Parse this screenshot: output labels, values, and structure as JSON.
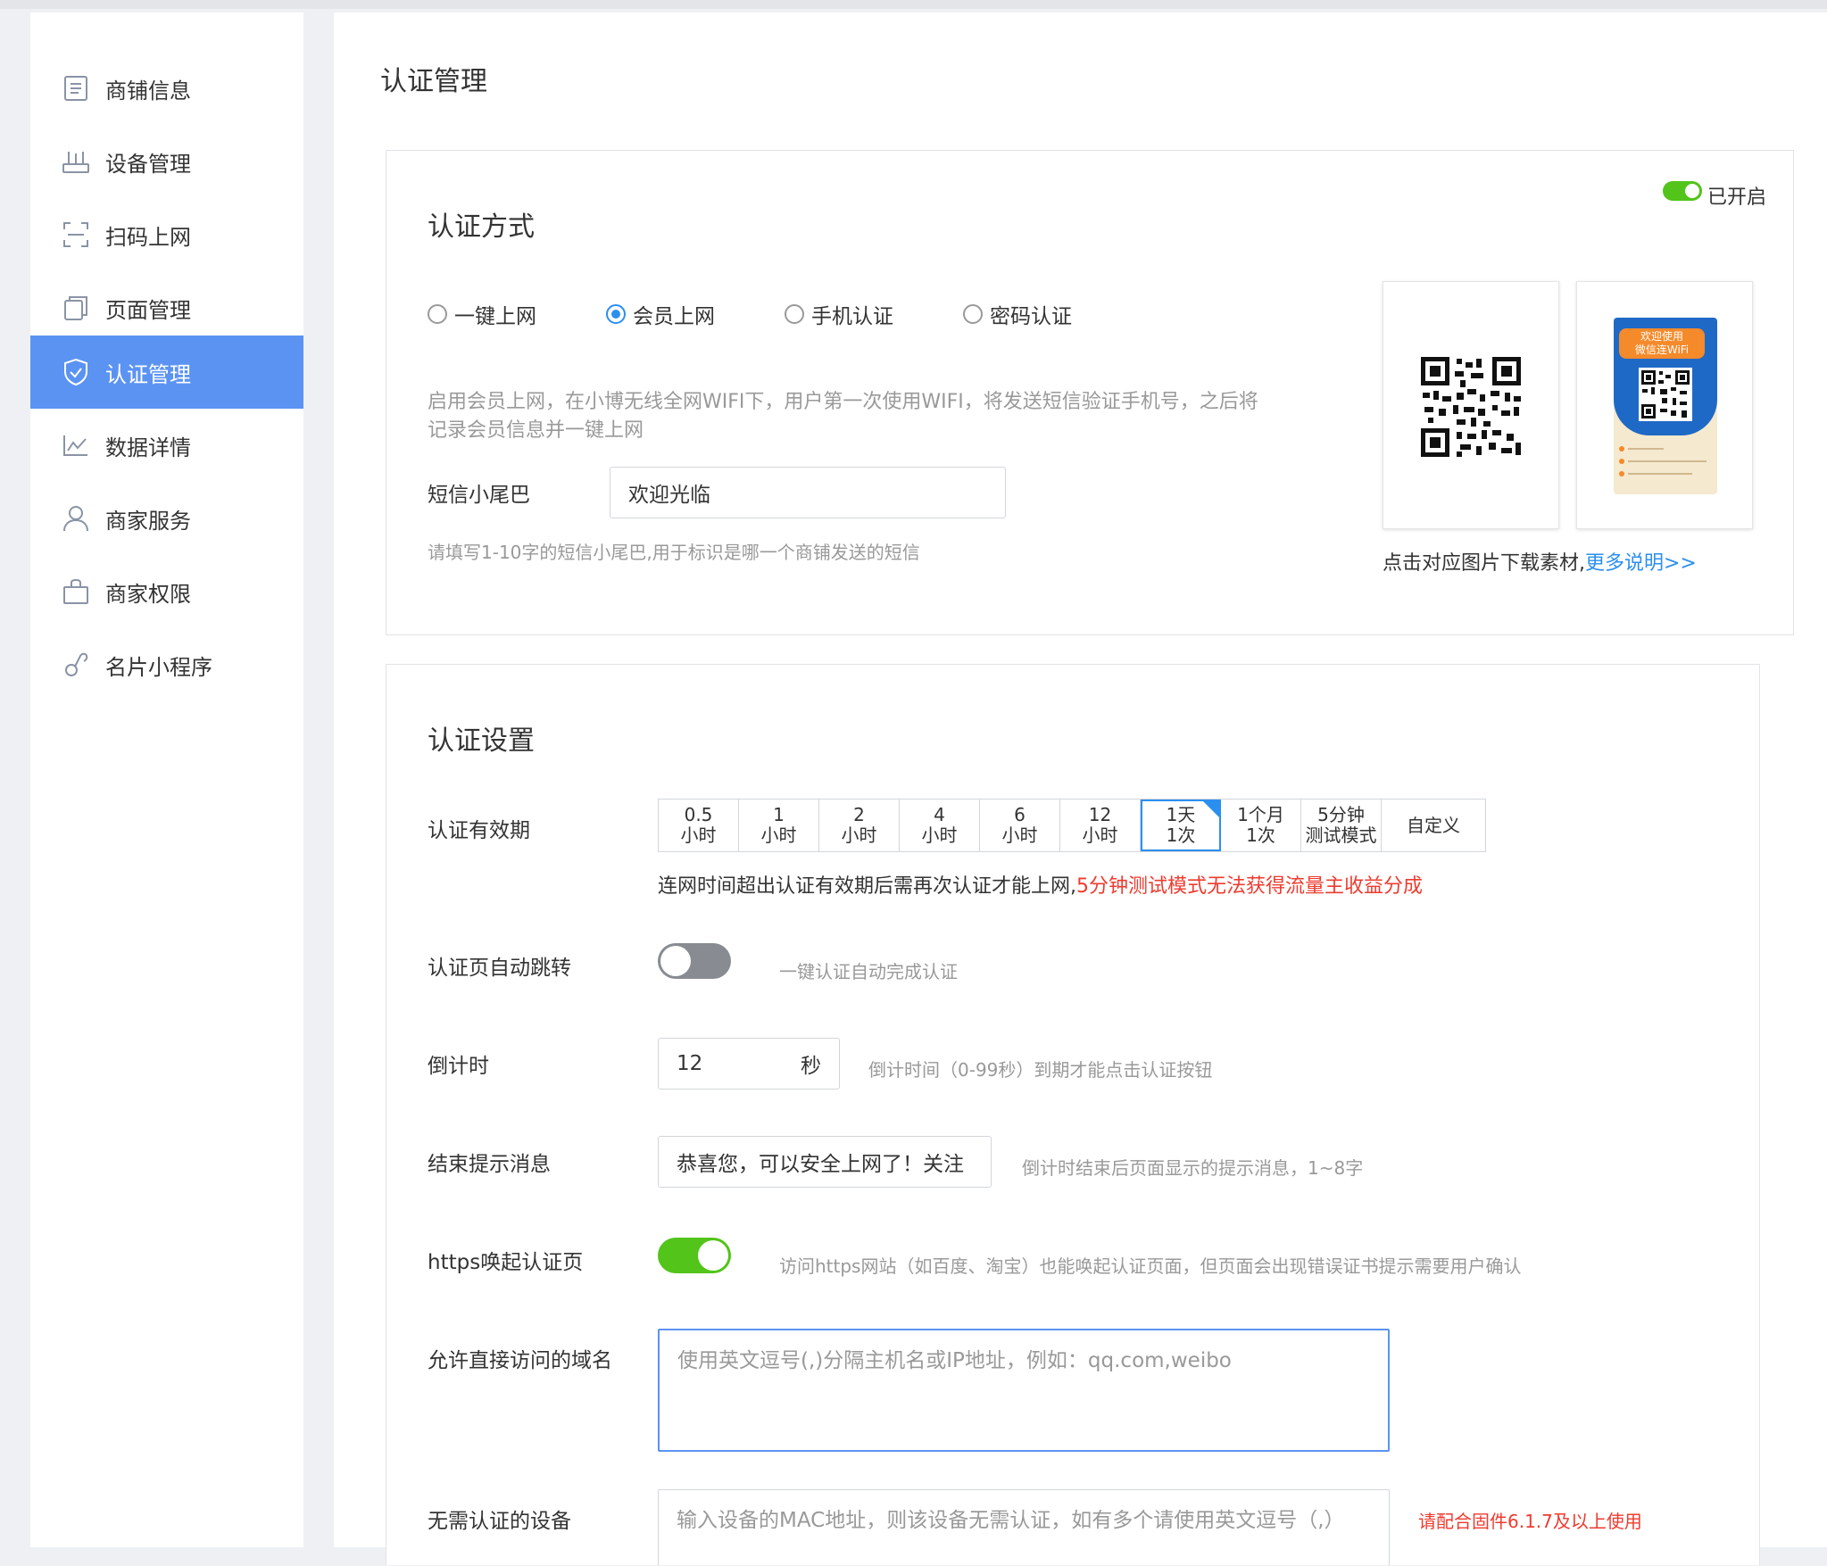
{
  "sidebar": {
    "items": [
      {
        "label": "商铺信息",
        "icon": "document-icon",
        "active": false
      },
      {
        "label": "设备管理",
        "icon": "router-icon",
        "active": false
      },
      {
        "label": "扫码上网",
        "icon": "scan-icon",
        "active": false
      },
      {
        "label": "页面管理",
        "icon": "pages-icon",
        "active": false
      },
      {
        "label": "认证管理",
        "icon": "shield-check-icon",
        "active": true
      },
      {
        "label": "数据详情",
        "icon": "chart-line-icon",
        "active": false
      },
      {
        "label": "商家服务",
        "icon": "user-icon",
        "active": false
      },
      {
        "label": "商家权限",
        "icon": "bag-icon",
        "active": false
      },
      {
        "label": "名片小程序",
        "icon": "link-icon",
        "active": false
      }
    ]
  },
  "page": {
    "title": "认证管理"
  },
  "auth_method": {
    "title": "认证方式",
    "toggle_label": "已开启",
    "toggle_on": true,
    "options": [
      {
        "label": "一键上网",
        "checked": false
      },
      {
        "label": "会员上网",
        "checked": true
      },
      {
        "label": "手机认证",
        "checked": false
      },
      {
        "label": "密码认证",
        "checked": false
      }
    ],
    "description_line1": "启用会员上网，在小博无线全网WIFI下，用户第一次使用WIFI，将发送短信验证手机号，之后将",
    "description_line2": "记录会员信息并一键上网",
    "sms_tail_label": "短信小尾巴",
    "sms_tail_value": "欢迎光临",
    "sms_tail_hint": "请填写1-10字的短信小尾巴,用于标识是哪一个商铺发送的短信",
    "poster_title_line1": "欢迎使用",
    "poster_title_line2": "微信连WiFi",
    "download_text": "点击对应图片下载素材,",
    "more_link": "更多说明>>"
  },
  "auth_settings": {
    "title": "认证设置",
    "validity_label": "认证有效期",
    "validity_options": [
      {
        "line1": "0.5",
        "line2": "小时",
        "active": false
      },
      {
        "line1": "1",
        "line2": "小时",
        "active": false
      },
      {
        "line1": "2",
        "line2": "小时",
        "active": false
      },
      {
        "line1": "4",
        "line2": "小时",
        "active": false
      },
      {
        "line1": "6",
        "line2": "小时",
        "active": false
      },
      {
        "line1": "12",
        "line2": "小时",
        "active": false
      },
      {
        "line1": "1天",
        "line2": "1次",
        "active": true
      },
      {
        "line1": "1个月",
        "line2": "1次",
        "active": false
      },
      {
        "line1": "5分钟",
        "line2": "测试模式",
        "active": false
      },
      {
        "line1": "自定义",
        "line2": "",
        "active": false
      }
    ],
    "validity_note": "连网时间超出认证有效期后需再次认证才能上网,",
    "validity_warning": "5分钟测试模式无法获得流量主收益分成",
    "auto_jump_label": "认证页自动跳转",
    "auto_jump_on": false,
    "auto_jump_hint": "一键认证自动完成认证",
    "countdown_label": "倒计时",
    "countdown_value": "12",
    "countdown_unit": "秒",
    "countdown_hint": "倒计时间（0-99秒）到期才能点击认证按钮",
    "end_msg_label": "结束提示消息",
    "end_msg_value": "恭喜您，可以安全上网了！关注",
    "end_msg_hint": "倒计时结束后页面显示的提示消息，1~8字",
    "https_label": "https唤起认证页",
    "https_on": true,
    "https_hint": "访问https网站（如百度、淘宝）也能唤起认证页面，但页面会出现错误证书提示需要用户确认",
    "domains_label": "允许直接访问的域名",
    "domains_placeholder": "使用英文逗号(,)分隔主机名或IP地址，例如：qq.com,weibo",
    "no_auth_label": "无需认证的设备",
    "no_auth_placeholder": "输入设备的MAC地址，则该设备无需认证，如有多个请使用英文逗号（,）",
    "no_auth_hint": "请配合固件6.1.7及以上使用"
  },
  "colors": {
    "accent": "#5b93f2",
    "link": "#2b8ff0",
    "toggle_on": "#52c41a",
    "warning": "#ee3b2f"
  }
}
